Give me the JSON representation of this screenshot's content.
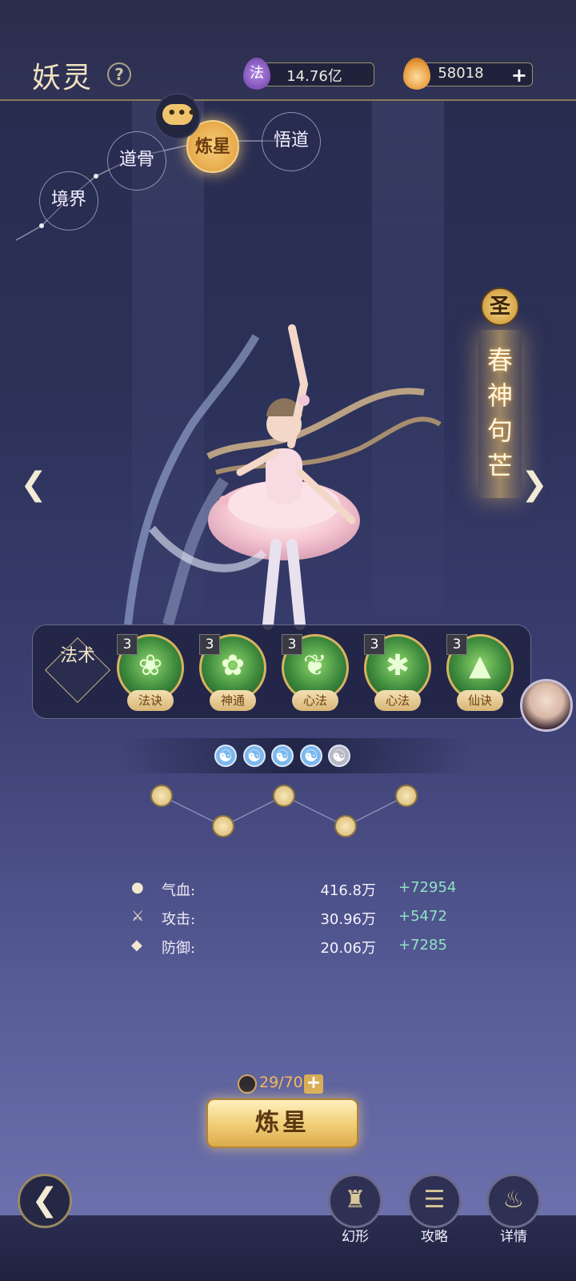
{
  "header": {
    "title": "妖灵",
    "help_icon": "?",
    "currency_fa": {
      "icon_label": "法",
      "value": "14.76亿"
    },
    "currency_flame": {
      "value": "58018",
      "plus": "+"
    }
  },
  "nav": {
    "items": [
      {
        "label": "境界"
      },
      {
        "label": "道骨"
      },
      {
        "label": "炼星",
        "active": true
      },
      {
        "label": "悟道"
      }
    ],
    "chat_dots": "•••"
  },
  "character": {
    "rank_badge": "圣",
    "name": "春神句芒"
  },
  "skills": {
    "tag": "法术",
    "items": [
      {
        "level": "3",
        "label": "法诀",
        "icon": "leaf-swirl-icon"
      },
      {
        "level": "3",
        "label": "神通",
        "icon": "lily-icon"
      },
      {
        "level": "3",
        "label": "心法",
        "icon": "leaf-icon"
      },
      {
        "level": "3",
        "label": "心法",
        "icon": "flower-icon"
      },
      {
        "level": "3",
        "label": "仙诀",
        "icon": "tree-icon"
      }
    ]
  },
  "yinyang": {
    "active": 4,
    "total": 5
  },
  "stats": [
    {
      "icon": "drop-icon",
      "label": "气血:",
      "value": "416.8万",
      "bonus": "+72954"
    },
    {
      "icon": "sword-icon",
      "label": "攻击:",
      "value": "30.96万",
      "bonus": "+5472"
    },
    {
      "icon": "shield-icon",
      "label": "防御:",
      "value": "20.06万",
      "bonus": "+7285"
    }
  ],
  "star_counter": "29/70",
  "main_button": "炼星",
  "bottom": {
    "buttons": [
      {
        "label": "幻形",
        "icon": "robe-icon"
      },
      {
        "label": "攻略",
        "icon": "scroll-icon"
      },
      {
        "label": "详情",
        "icon": "cauldron-icon"
      }
    ]
  }
}
